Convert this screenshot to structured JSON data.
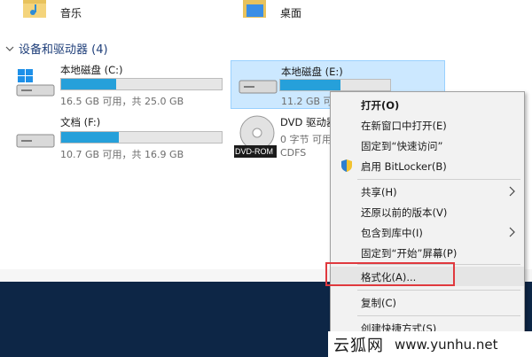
{
  "folders": [
    {
      "label": "音乐",
      "icon": "music-folder-icon"
    },
    {
      "label": "桌面",
      "icon": "desktop-folder-icon"
    }
  ],
  "section": {
    "title": "设备和驱动器 (4)"
  },
  "drives": [
    {
      "name": "本地磁盘 (C:)",
      "sub": "16.5 GB 可用，共 25.0 GB",
      "fill": 0.34,
      "icon": "windows-drive-icon"
    },
    {
      "name": "本地磁盘 (E:)",
      "sub": "11.2 GB 可用",
      "fill": 0.55,
      "icon": "hard-drive-icon",
      "selected": true
    },
    {
      "name": "文档 (F:)",
      "sub": "10.7 GB 可用，共 16.9 GB",
      "fill": 0.36,
      "icon": "hard-drive-icon"
    },
    {
      "name": "DVD 驱动器",
      "sub": "0 字节 可用",
      "sub2": "CDFS",
      "icon": "dvd-rom-icon",
      "icon_text": "DVD-ROM"
    }
  ],
  "context_menu": {
    "items": [
      {
        "label": "打开(O)",
        "bold": true
      },
      {
        "label": "在新窗口中打开(E)"
      },
      {
        "label": "固定到“快速访问”"
      },
      {
        "label": "启用 BitLocker(B)",
        "icon": "shield-icon"
      },
      {
        "label": "共享(H)",
        "submenu": true
      },
      {
        "label": "还原以前的版本(V)"
      },
      {
        "label": "包含到库中(I)",
        "submenu": true
      },
      {
        "label": "固定到“开始”屏幕(P)"
      },
      {
        "label": "格式化(A)...",
        "highlighted": true
      },
      {
        "label": "复制(C)"
      },
      {
        "label": "创建快捷方式(S)"
      }
    ]
  },
  "watermark": {
    "cn": "云狐网",
    "url": "www.yunhu.net"
  },
  "colors": {
    "accent": "#26a0da",
    "highlight": "#e0393e",
    "selection": "#cce8ff",
    "dark": "#0d2646"
  }
}
